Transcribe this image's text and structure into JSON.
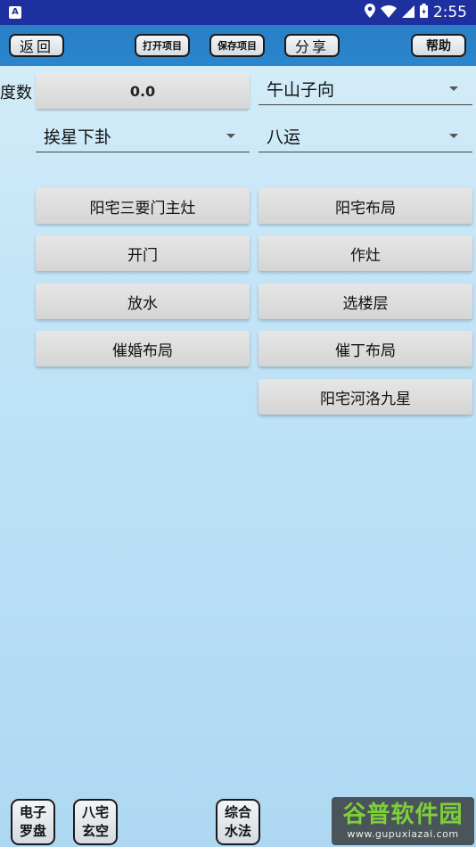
{
  "status_bar": {
    "app_badge": "A",
    "time": "2:55",
    "icons": [
      "location-icon",
      "wifi-icon",
      "signal-icon",
      "battery-icon"
    ]
  },
  "toolbar": {
    "back": "返回",
    "open_project": "打开项目",
    "save_project": "保存项目",
    "share": "分享",
    "help": "帮助"
  },
  "form": {
    "degree_label": "度数",
    "degree_value": "0.0",
    "facing": "午山子向",
    "star_method": "挨星下卦",
    "period": "八运"
  },
  "buttons": {
    "left": [
      "阳宅三要门主灶",
      "开门",
      "放水",
      "催婚布局"
    ],
    "right": [
      "阳宅布局",
      "作灶",
      "选楼层",
      "催丁布局",
      "阳宅河洛九星"
    ]
  },
  "bottom_bar": {
    "compass": [
      "电子",
      "罗盘"
    ],
    "eight_mansions": [
      "八宅",
      "玄空"
    ],
    "water_method": [
      "综合",
      "水法"
    ]
  },
  "watermark": {
    "title": "谷普软件园",
    "url": "www.gupuxiazai.com"
  }
}
